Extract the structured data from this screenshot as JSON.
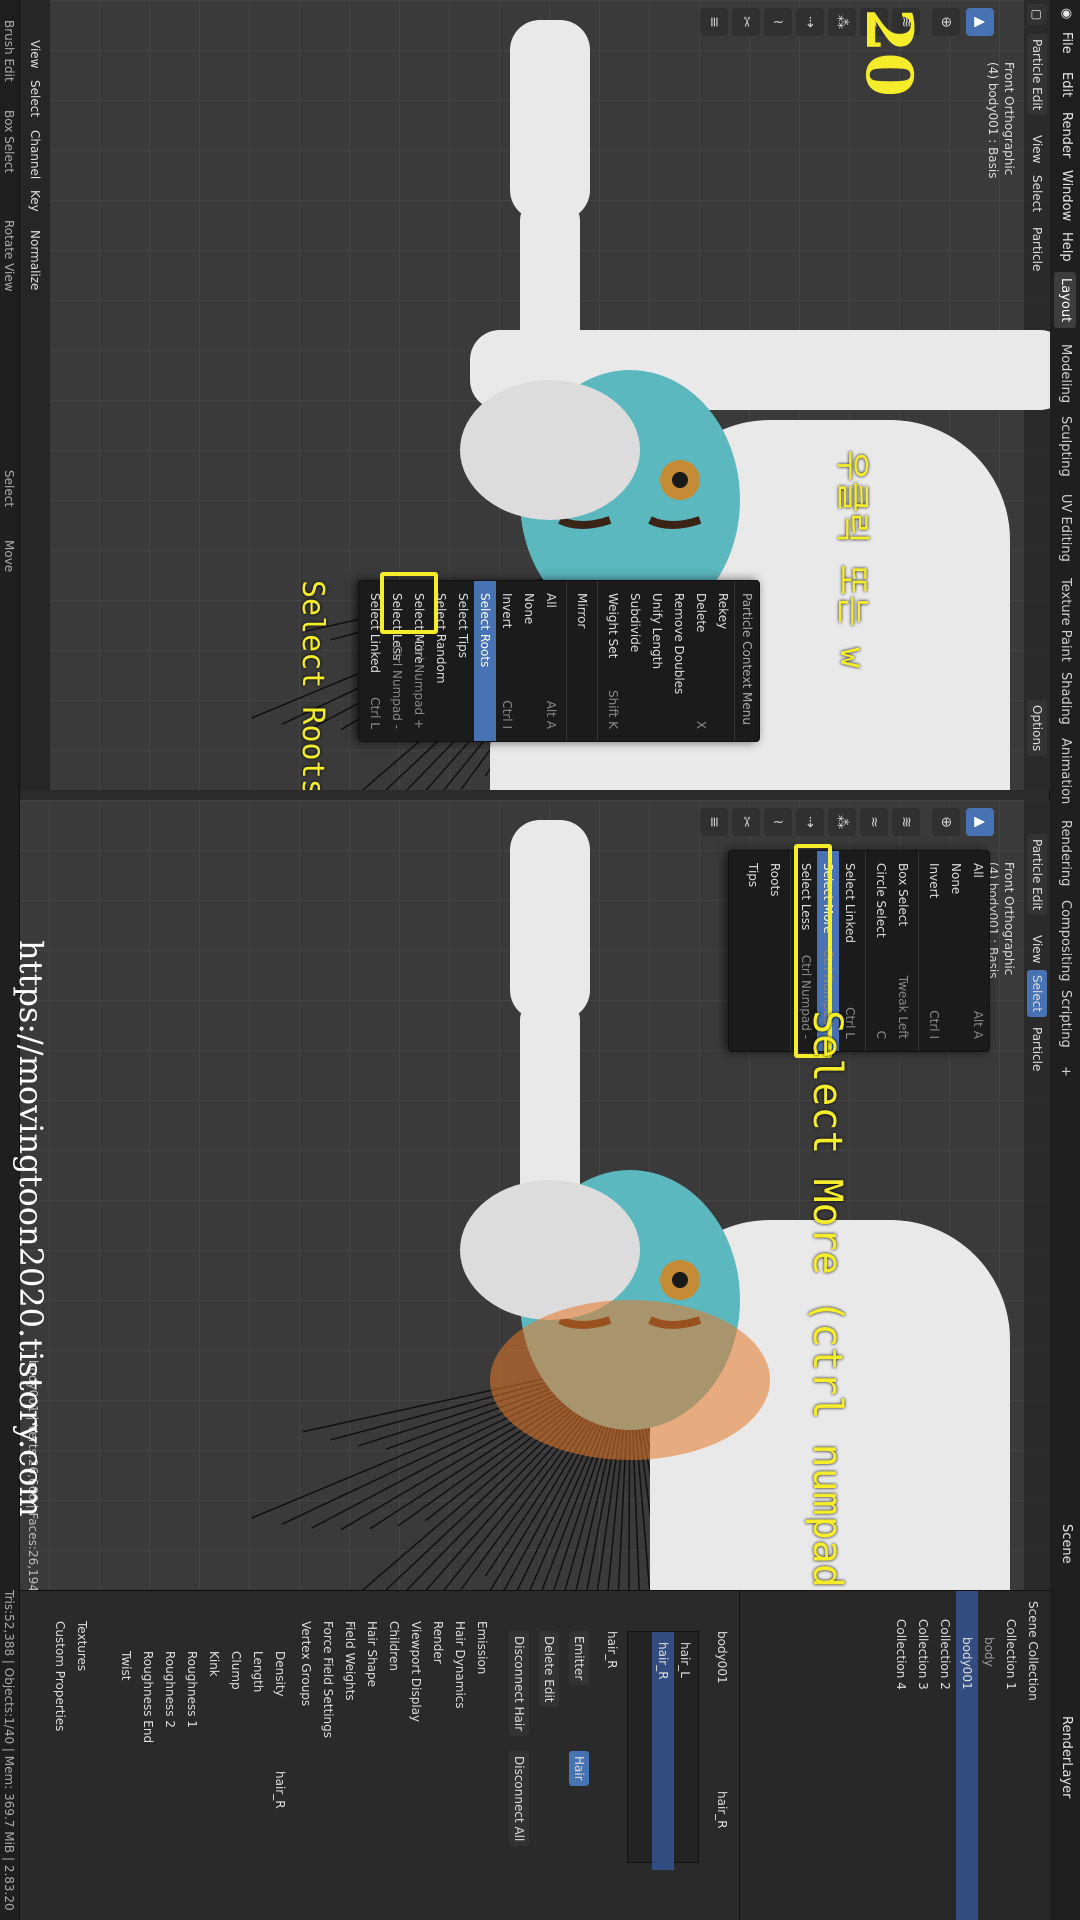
{
  "menubar": {
    "items": [
      "File",
      "Edit",
      "Render",
      "Window",
      "Help"
    ],
    "workspaces": [
      "Layout",
      "Modeling",
      "Sculpting",
      "UV Editing",
      "Texture Paint",
      "Shading",
      "Animation",
      "Rendering",
      "Compositing",
      "Scripting"
    ],
    "active_workspace": "Layout",
    "scene": "Scene",
    "view_layer": "RenderLayer"
  },
  "left_view": {
    "mode": "Particle Edit",
    "menus": [
      "View",
      "Select",
      "Particle"
    ],
    "view_name": "Front Orthographic",
    "object_info": "(4) body001 : Basis",
    "options": "Options",
    "step_number": "20",
    "annotation_korean": "우클릭 또는 w",
    "annotation_select": "Select Roots",
    "context_menu": {
      "title": "Particle Context Menu",
      "items": [
        {
          "label": "Rekey",
          "shortcut": ""
        },
        {
          "label": "Delete",
          "shortcut": "X"
        },
        {
          "label": "Remove Doubles",
          "shortcut": ""
        },
        {
          "label": "Unify Length",
          "shortcut": ""
        },
        {
          "label": "Subdivide",
          "shortcut": ""
        },
        {
          "label": "Weight Set",
          "shortcut": "Shift K"
        },
        {
          "label": "Mirror",
          "shortcut": ""
        },
        {
          "label": "All",
          "shortcut": "Alt A"
        },
        {
          "label": "None",
          "shortcut": ""
        },
        {
          "label": "Invert",
          "shortcut": "Ctrl I"
        },
        {
          "label": "Select Roots",
          "shortcut": ""
        },
        {
          "label": "Select Tips",
          "shortcut": ""
        },
        {
          "label": "Select Random",
          "shortcut": ""
        },
        {
          "label": "Select More",
          "shortcut": "Ctrl Numpad +"
        },
        {
          "label": "Select Less",
          "shortcut": "Ctrl Numpad -"
        },
        {
          "label": "Select Linked",
          "shortcut": "Ctrl L"
        }
      ]
    },
    "dopesheet_menus": [
      "View",
      "Select",
      "Channel",
      "Key"
    ],
    "normalize": "Normalize",
    "brush_edit": "Brush Edit",
    "box_select": "Box Select",
    "rotate_view": "Rotate View",
    "status_select": "Select",
    "status_move": "Move"
  },
  "right_view": {
    "mode": "Particle Edit",
    "menus": [
      "View",
      "Select",
      "Particle"
    ],
    "view_name": "Front Orthographic",
    "object_info": "(4) body001 : Basis",
    "annotation": "Select More (ctrl numpad +)",
    "select_menu": {
      "items": [
        {
          "label": "All",
          "shortcut": "Alt A"
        },
        {
          "label": "None",
          "shortcut": ""
        },
        {
          "label": "Invert",
          "shortcut": "Ctrl I"
        },
        {
          "label": "Box Select",
          "shortcut": "Tweak Left"
        },
        {
          "label": "Circle Select",
          "shortcut": "C"
        },
        {
          "label": "Select Linked",
          "shortcut": "Ctrl L"
        },
        {
          "label": "Select More",
          "shortcut": "Ctrl Numpad +"
        },
        {
          "label": "Select Less",
          "shortcut": "Ctrl Numpad -"
        },
        {
          "label": "Roots",
          "shortcut": ""
        },
        {
          "label": "Tips",
          "shortcut": ""
        }
      ]
    },
    "stats": "body001 | Verts:26,666 | Faces:26,194"
  },
  "outliner": {
    "rows": [
      {
        "label": "Scene Collection",
        "indent": 0
      },
      {
        "label": "Collection 1",
        "indent": 1
      },
      {
        "label": "body",
        "indent": 2
      },
      {
        "label": "body001",
        "indent": 2,
        "selected": true
      },
      {
        "label": "Collection 2",
        "indent": 1
      },
      {
        "label": "Collection 3",
        "indent": 1
      },
      {
        "label": "Collection 4",
        "indent": 1
      }
    ]
  },
  "properties": {
    "object": "body001",
    "particle_system": "hair_R",
    "systems": [
      "hair_L",
      "hair_R"
    ],
    "settings": "hair_R",
    "emitter_tab": "Emitter",
    "hair_tab": "Hair",
    "buttons": [
      "Delete Edit",
      "Disconnect Hair",
      "Disconnect All"
    ],
    "sections": [
      "Emission",
      "Hair Dynamics",
      "Render",
      "Viewport Display",
      "Children",
      "Hair Shape",
      "Field Weights",
      "Force Field Settings",
      "Vertex Groups"
    ],
    "vgroup_rows": [
      "Density",
      "Length",
      "Clump",
      "Kink",
      "Roughness 1",
      "Roughness 2",
      "Roughness End",
      "Twist"
    ],
    "vgroup_value": "hair_R",
    "bottom_sections": [
      "Textures",
      "Custom Properties"
    ]
  },
  "statusbar": {
    "text": "Tris:52,388 | Objects:1/40 | Mem: 369.7 MiB | 2.83.20"
  },
  "watermark": "https://movingtoon2020.tistory.com",
  "colors": {
    "highlight": "#4772b3",
    "annotation": "#f5ec2a",
    "face": "#5bb8bf",
    "selected_hair": "#e8782a"
  }
}
